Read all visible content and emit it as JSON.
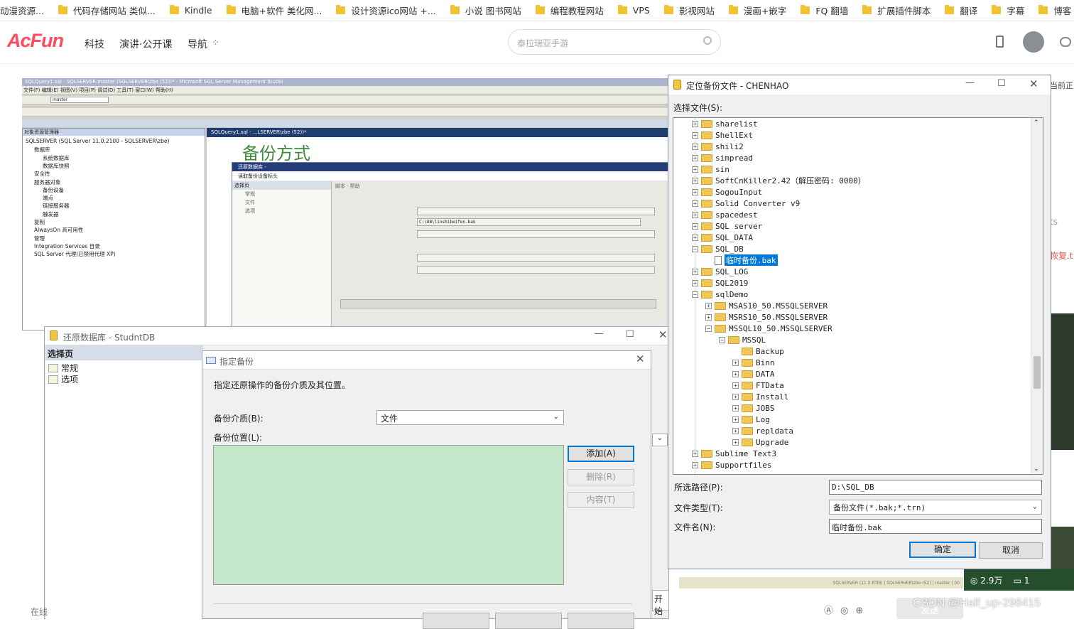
{
  "bookmarks": [
    "动漫资源...",
    "代码存储网站 类似...",
    "Kindle",
    "电脑+软件 美化网...",
    "设计资源ico网站 +...",
    "小说 图书网站",
    "编程教程网站",
    "VPS",
    "影视网站",
    "漫画+嵌字",
    "FQ 翻墙",
    "扩展插件脚本",
    "翻译",
    "字幕",
    "博客 技巧教程 论坛..."
  ],
  "acfun": {
    "logo": "AcFun",
    "nav": [
      "科技",
      "演讲·公开课",
      "导航"
    ],
    "search_placeholder": "泰拉瑞亚手游"
  },
  "ssms": {
    "title": "SQLQuery1.sql - SQLSERVER.master (SQLSERVER\\zbe (52))* - Microsoft SQL Server Management Studio",
    "menu": "文件(F)  编辑(E)  视图(V)  项目(P)  调试(D)  工具(T)  窗口(W)  帮助(H)",
    "db_combo": "master",
    "explorer_title": "对象资源管理器",
    "explorer_items": [
      "SQLSERVER (SQL Server 11.0.2100 - SQLSERVER\\zbe)",
      "数据库",
      "系统数据库",
      "数据库快照",
      "安全性",
      "服务器对象",
      "备份设备",
      "端点",
      "链接服务器",
      "触发器",
      "复制",
      "AlwaysOn 高可用性",
      "管理",
      "Integration Services 目录",
      "SQL Server 代理(已禁用代理 XP)"
    ],
    "doc_tab": "SQLQuery1.sql - ...LSERVER\\zbe (52))*",
    "heading": "备份方式",
    "restore_title": "还原数据库 -",
    "restore_sub": "读取备份设备标头",
    "restore_pages": [
      "选择页",
      "常规",
      "文件",
      "选项"
    ],
    "restore_toolbar": "脚本 · 帮助",
    "restore_path": "C:\\DB\\linshibeifen.bak"
  },
  "restore": {
    "title": "还原数据库 - StudntDB",
    "pages_header": "选择页",
    "pages": [
      "常规",
      "选项"
    ],
    "status": "在线",
    "start": "开始"
  },
  "specify": {
    "title": "指定备份",
    "desc": "指定还原操作的备份介质及其位置。",
    "media_label": "备份介质(B):",
    "media_value": "文件",
    "location_label": "备份位置(L):",
    "add": "添加(A)",
    "remove": "删除(R)",
    "contents": "内容(T)"
  },
  "locate": {
    "title": "定位备份文件 - CHENHAO",
    "select_label": "选择文件(S):",
    "tree": [
      {
        "label": "sharelist",
        "d": 1,
        "t": "+"
      },
      {
        "label": "ShellExt",
        "d": 1,
        "t": "+"
      },
      {
        "label": "shili2",
        "d": 1,
        "t": "+"
      },
      {
        "label": "simpread",
        "d": 1,
        "t": "+"
      },
      {
        "label": "sin",
        "d": 1,
        "t": "+"
      },
      {
        "label": "SoftCnKiller2.42（解压密码: 0000）",
        "d": 1,
        "t": "+"
      },
      {
        "label": "SogouInput",
        "d": 1,
        "t": "+"
      },
      {
        "label": "Solid Converter v9",
        "d": 1,
        "t": "+"
      },
      {
        "label": "spacedest",
        "d": 1,
        "t": "+"
      },
      {
        "label": "SQL server",
        "d": 1,
        "t": "+"
      },
      {
        "label": "SQL_DATA",
        "d": 1,
        "t": "+"
      },
      {
        "label": "SQL_DB",
        "d": 1,
        "t": "-"
      },
      {
        "label": "临时备份.bak",
        "d": 2,
        "t": "",
        "file": true,
        "selected": true
      },
      {
        "label": "SQL_LOG",
        "d": 1,
        "t": "+"
      },
      {
        "label": "SQL2019",
        "d": 1,
        "t": "+"
      },
      {
        "label": "sqlDemo",
        "d": 1,
        "t": "-"
      },
      {
        "label": "MSAS10_50.MSSQLSERVER",
        "d": 2,
        "t": "+"
      },
      {
        "label": "MSRS10_50.MSSQLSERVER",
        "d": 2,
        "t": "+"
      },
      {
        "label": "MSSQL10_50.MSSQLSERVER",
        "d": 2,
        "t": "-"
      },
      {
        "label": "MSSQL",
        "d": 3,
        "t": "-"
      },
      {
        "label": "Backup",
        "d": 4,
        "t": ""
      },
      {
        "label": "Binn",
        "d": 4,
        "t": "+"
      },
      {
        "label": "DATA",
        "d": 4,
        "t": "+"
      },
      {
        "label": "FTData",
        "d": 4,
        "t": "+"
      },
      {
        "label": "Install",
        "d": 4,
        "t": "+"
      },
      {
        "label": "JOBS",
        "d": 4,
        "t": "+"
      },
      {
        "label": "Log",
        "d": 4,
        "t": "+"
      },
      {
        "label": "repldata",
        "d": 4,
        "t": "+"
      },
      {
        "label": "Upgrade",
        "d": 4,
        "t": "+"
      },
      {
        "label": "Sublime Text3",
        "d": 1,
        "t": "+"
      },
      {
        "label": "Supportfiles",
        "d": 1,
        "t": "+"
      }
    ],
    "path_label": "所选路径(P):",
    "path_value": "D:\\SQL_DB",
    "type_label": "文件类型(T):",
    "type_value": "备份文件(*.bak;*.trn)",
    "name_label": "文件名(N):",
    "name_value": "临时备份.bak",
    "ok": "确定",
    "cancel": "取消"
  },
  "side": {
    "t1": "当前正",
    "t2": "ts",
    "t3": "恢复.t",
    "views": "2.9万",
    "comments": "1",
    "send": "发送"
  },
  "watermark": "CSDN @Half_up-298415"
}
